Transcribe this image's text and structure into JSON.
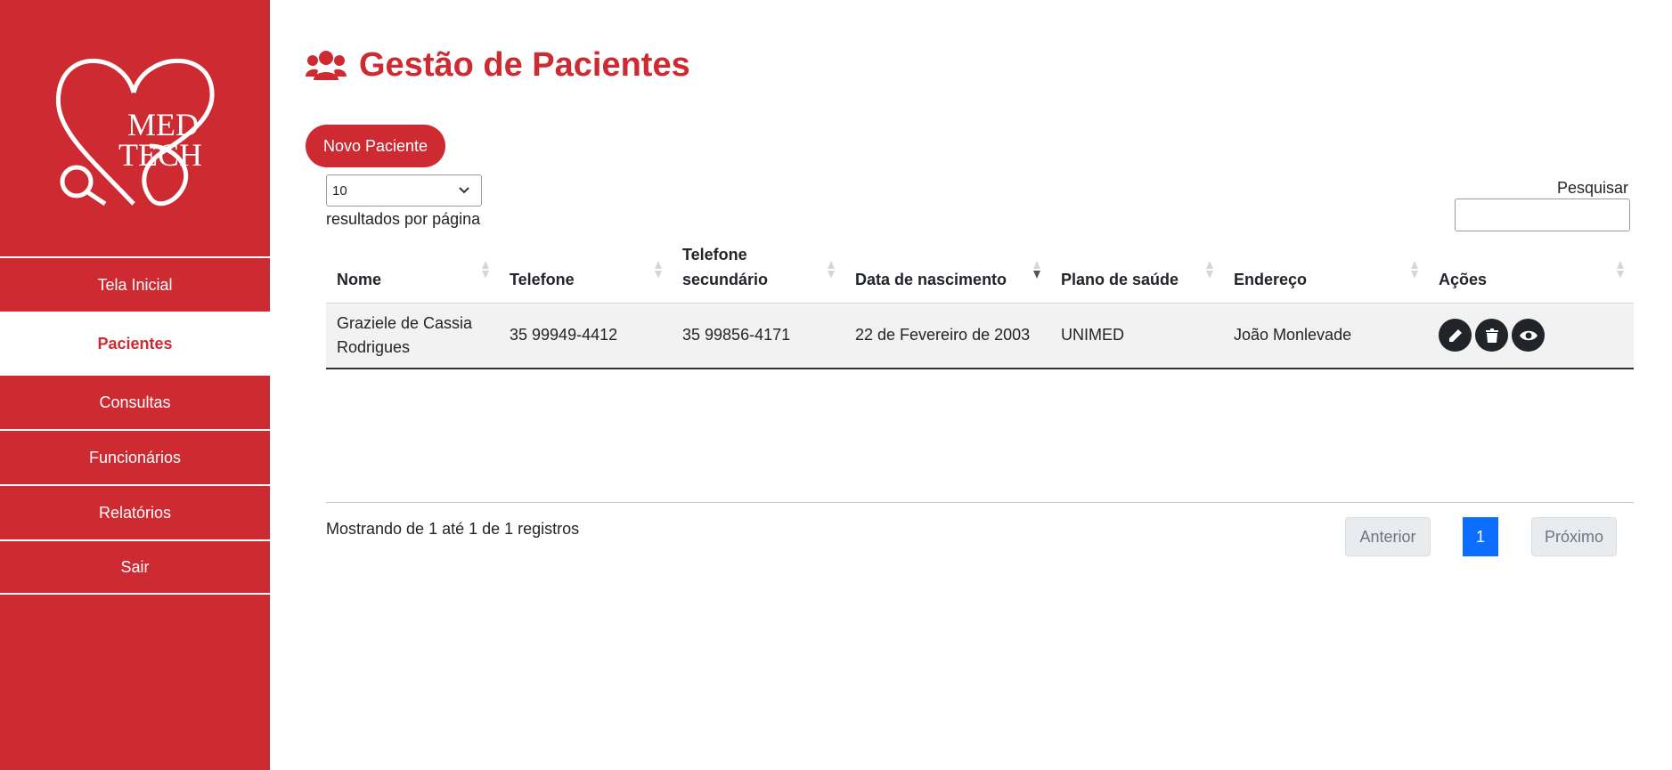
{
  "brand": {
    "logo_line1": "MED",
    "logo_line2": "TECH",
    "color": "#cd2a32"
  },
  "sidebar": {
    "items": [
      {
        "label": "Tela Inicial",
        "active": false
      },
      {
        "label": "Pacientes",
        "active": true
      },
      {
        "label": "Consultas",
        "active": false
      },
      {
        "label": "Funcionários",
        "active": false
      },
      {
        "label": "Relatórios",
        "active": false
      },
      {
        "label": "Sair",
        "active": false
      }
    ]
  },
  "header": {
    "title": "Gestão de Pacientes",
    "icon": "users-icon"
  },
  "toolbar": {
    "new_label": "Novo Paciente"
  },
  "length": {
    "value": "10",
    "label": "resultados por página"
  },
  "search": {
    "label": "Pesquisar",
    "value": ""
  },
  "table": {
    "columns": [
      "Nome",
      "Telefone",
      "Telefone secundário",
      "Data de nascimento",
      "Plano de saúde",
      "Endereço",
      "Ações"
    ],
    "rows": [
      {
        "nome": "Graziele de Cassia Rodrigues",
        "telefone": "35 99949-4412",
        "telefone2": "35 99856-4171",
        "nascimento": "22 de Fevereiro de 2003",
        "plano": "UNIMED",
        "endereco": "João Monlevade",
        "actions": [
          "edit-icon",
          "trash-icon",
          "eye-icon"
        ]
      }
    ]
  },
  "footer": {
    "info": "Mostrando de 1 até 1 de 1 registros",
    "prev": "Anterior",
    "page": "1",
    "next": "Próximo"
  }
}
